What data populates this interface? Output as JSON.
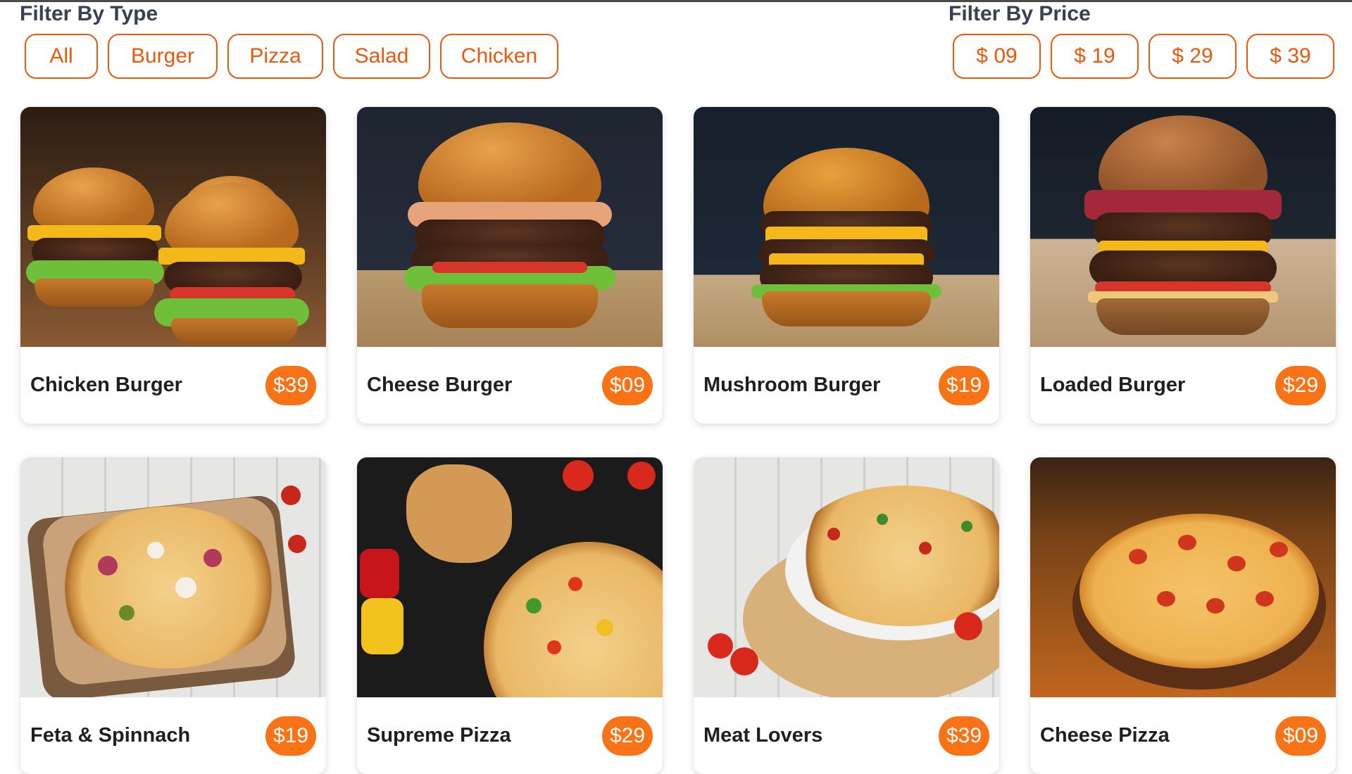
{
  "filters": {
    "type": {
      "title": "Filter By Type",
      "options": [
        "All",
        "Burger",
        "Pizza",
        "Salad",
        "Chicken"
      ]
    },
    "price": {
      "title": "Filter By Price",
      "options": [
        "$ 09",
        "$ 19",
        "$ 29",
        "$ 39"
      ]
    }
  },
  "items": [
    {
      "name": "Chicken Burger",
      "price": "$39"
    },
    {
      "name": "Cheese Burger",
      "price": "$09"
    },
    {
      "name": "Mushroom Burger",
      "price": "$19"
    },
    {
      "name": "Loaded Burger",
      "price": "$29"
    },
    {
      "name": "Feta & Spinnach",
      "price": "$19"
    },
    {
      "name": "Supreme Pizza",
      "price": "$29"
    },
    {
      "name": "Meat Lovers",
      "price": "$39"
    },
    {
      "name": "Cheese Pizza",
      "price": "$09"
    }
  ],
  "colors": {
    "accent": "#ea580c",
    "badge": "#f97316",
    "heading": "#374151"
  }
}
